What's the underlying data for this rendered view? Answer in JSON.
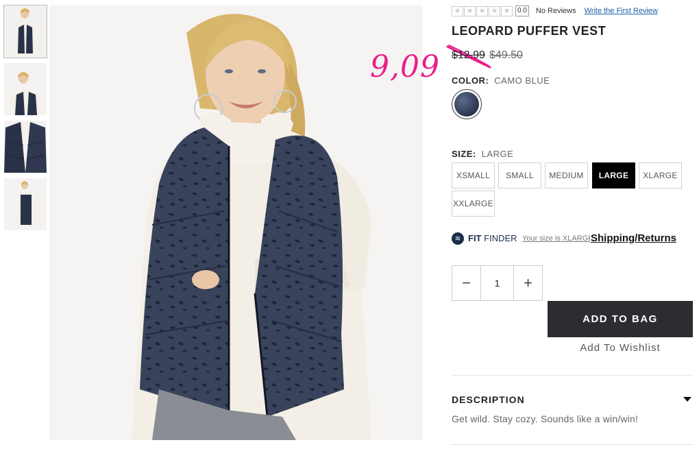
{
  "thumbnails": [
    {
      "name": "front view"
    },
    {
      "name": "pose view"
    },
    {
      "name": "vest detail"
    },
    {
      "name": "side view"
    }
  ],
  "rating": {
    "stars_filled": 0,
    "stars_total": 5,
    "score": "0.0",
    "no_reviews": "No Reviews",
    "write_review": "Write the First Review"
  },
  "product": {
    "title": "LEOPARD PUFFER VEST",
    "sale_price": "$12.99",
    "original_price": "$49.50",
    "handwritten_price": "9,09"
  },
  "color": {
    "label": "COLOR:",
    "value": "CAMO BLUE",
    "swatch_hex": "#3a4560"
  },
  "size": {
    "label": "SIZE:",
    "value": "LARGE",
    "options": [
      "XSMALL",
      "SMALL",
      "MEDIUM",
      "LARGE",
      "XLARGE",
      "XXLARGE"
    ],
    "selected": "LARGE"
  },
  "fit_finder": {
    "brand_bold": "FIT",
    "brand_rest": " FINDER",
    "your_size": "Your size is XLARGE",
    "shipping_link": "Shipping/Returns"
  },
  "quantity": {
    "minus": "−",
    "value": "1",
    "plus": "+"
  },
  "actions": {
    "add_to_bag": "ADD TO BAG",
    "add_to_wishlist": "Add To Wishlist"
  },
  "description": {
    "heading": "DESCRIPTION",
    "text": "Get wild. Stay cozy. Sounds like a win/win!"
  },
  "colors": {
    "accent_pink": "#ea1e8a",
    "button_dark": "#2b2d30",
    "link_blue": "#1a5fa8",
    "vest_navy": "#2a3248"
  }
}
